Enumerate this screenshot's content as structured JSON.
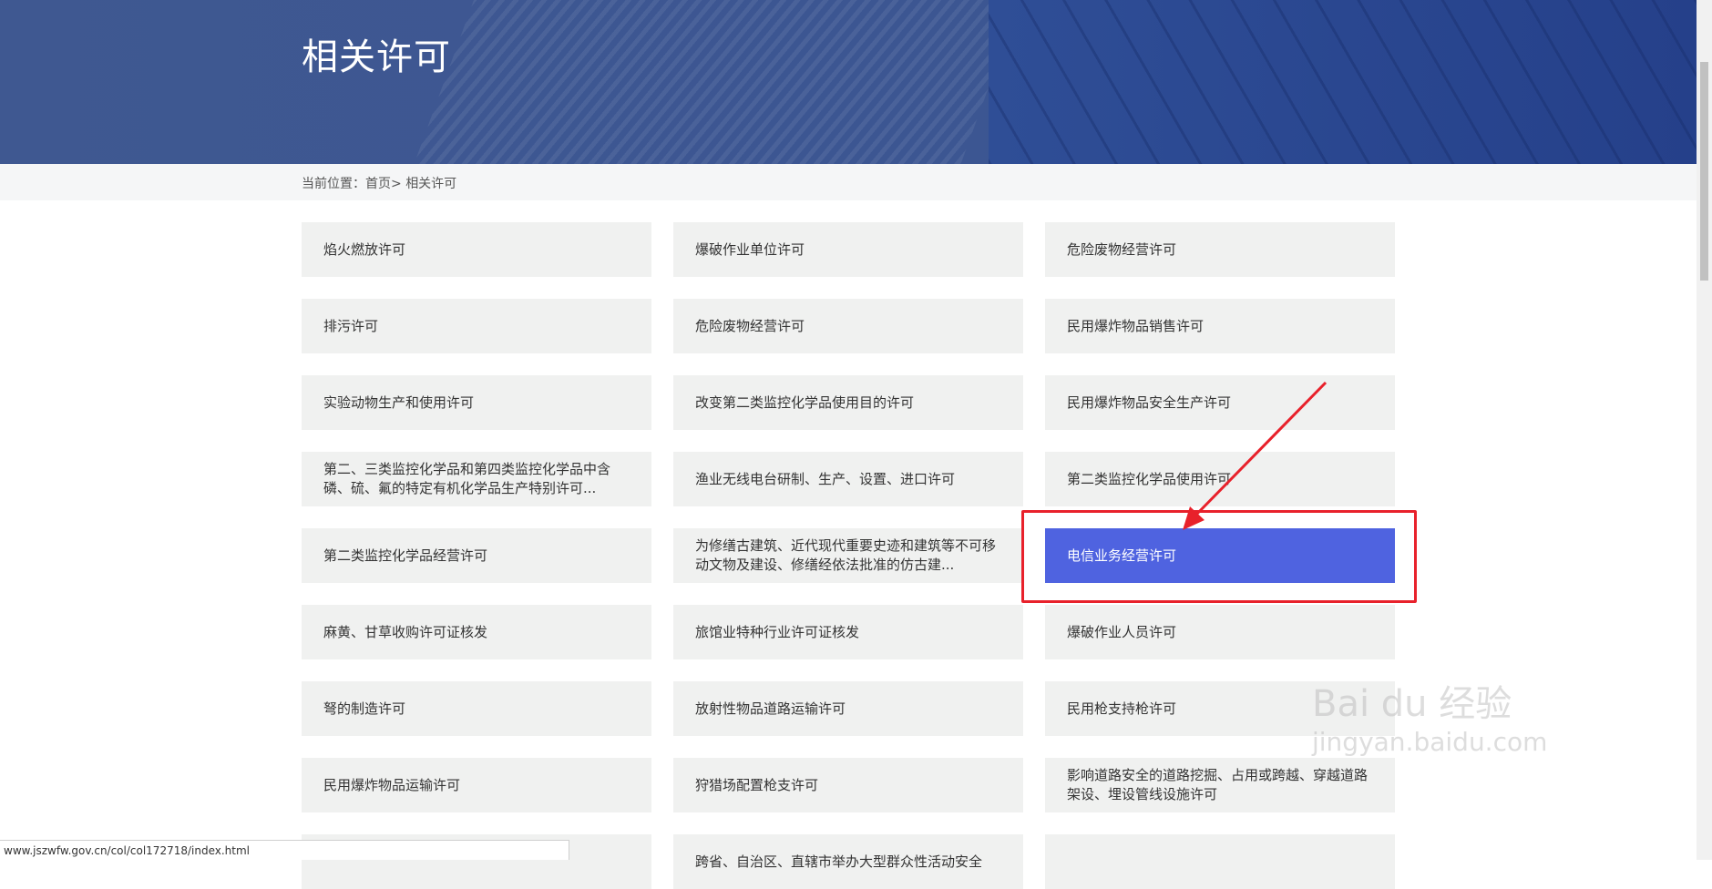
{
  "banner": {
    "title": "相关许可"
  },
  "breadcrumb": {
    "prefix": "当前位置：",
    "home": "首页",
    "separator": ">",
    "current": "相关许可"
  },
  "permits": [
    "焰火燃放许可",
    "爆破作业单位许可",
    "危险废物经营许可",
    "排污许可",
    "危险废物经营许可",
    "民用爆炸物品销售许可",
    "实验动物生产和使用许可",
    "改变第二类监控化学品使用目的许可",
    "民用爆炸物品安全生产许可",
    "第二、三类监控化学品和第四类监控化学品中含磷、硫、氟的特定有机化学品生产特别许可...",
    "渔业无线电台研制、生产、设置、进口许可",
    "第二类监控化学品使用许可",
    "第二类监控化学品经营许可",
    "为修缮古建筑、近代现代重要史迹和建筑等不可移动文物及建设、修缮经依法批准的仿古建...",
    "电信业务经营许可",
    "麻黄、甘草收购许可证核发",
    "旅馆业特种行业许可证核发",
    "爆破作业人员许可",
    "弩的制造许可",
    "放射性物品道路运输许可",
    "民用枪支持枪许可",
    "民用爆炸物品运输许可",
    "狩猎场配置枪支许可",
    "影响道路安全的道路挖掘、占用或跨越、穿越道路架设、埋设管线设施许可",
    "",
    "跨省、自治区、直辖市举办大型群众性活动安全",
    ""
  ],
  "active_index": 14,
  "status_url": "www.jszwfw.gov.cn/col/col172718/index.html",
  "watermark": {
    "brand": "Bai du 经验",
    "url": "jingyan.baidu.com"
  },
  "colors": {
    "banner": "#3c5692",
    "active": "#4f63e0",
    "highlight": "#e8212b"
  }
}
